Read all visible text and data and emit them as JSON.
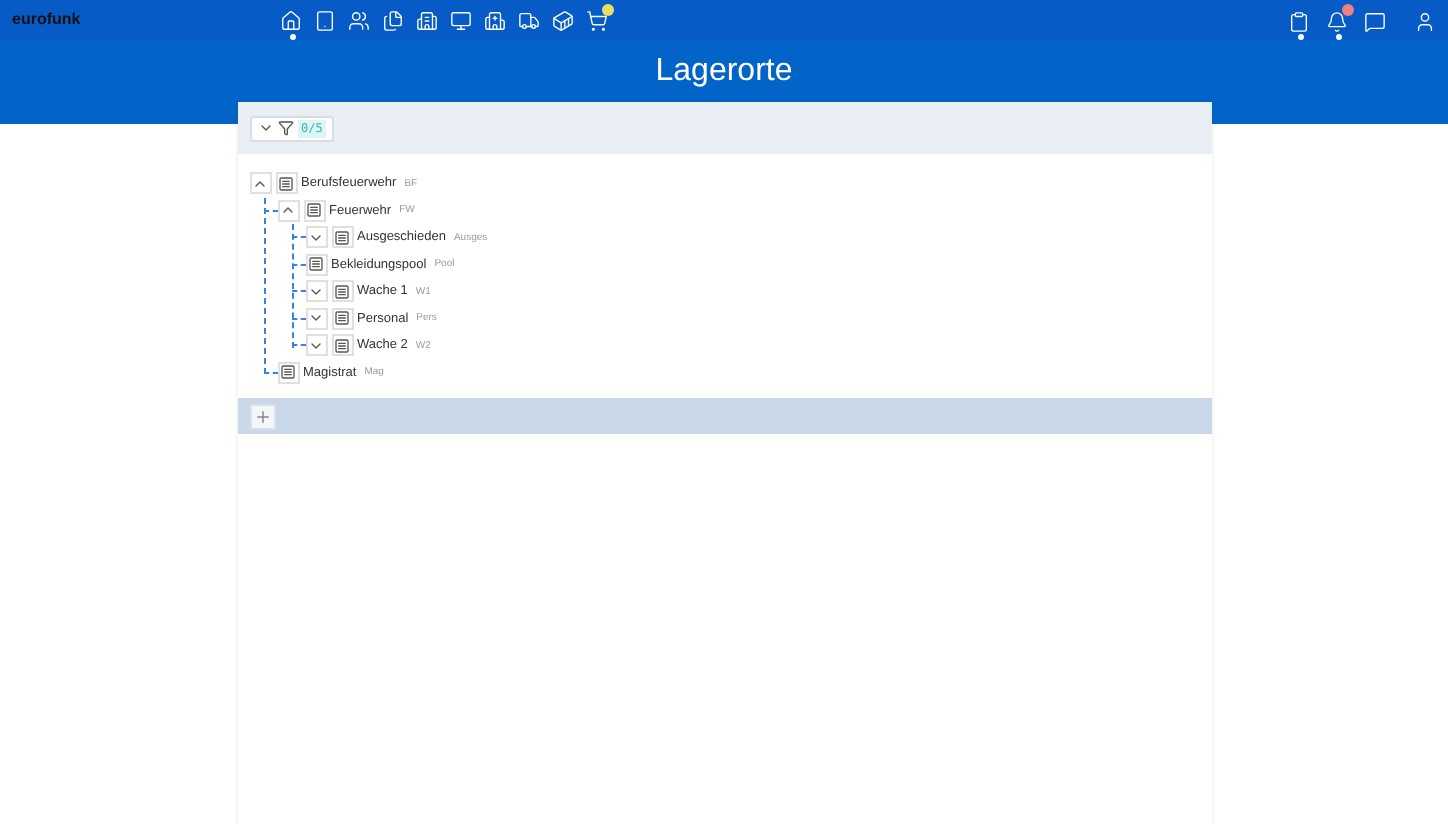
{
  "app": {
    "logo": "eurofunk"
  },
  "header": {
    "title": "Lagerorte"
  },
  "toolbar": {
    "filter_count": "0/5"
  },
  "tree": [
    {
      "name": "Berufsfeuerwehr",
      "code": "BF",
      "kind": "folder",
      "expanded": true,
      "children": [
        {
          "name": "Feuerwehr",
          "code": "FW",
          "kind": "folder",
          "expanded": true,
          "children": [
            {
              "name": "Ausgeschieden",
              "code": "Ausges",
              "kind": "folder",
              "expanded": false
            },
            {
              "name": "Bekleidungspool",
              "code": "Pool",
              "kind": "leaf"
            },
            {
              "name": "Wache 1",
              "code": "W1",
              "kind": "folder",
              "expanded": false
            },
            {
              "name": "Personal",
              "code": "Pers",
              "kind": "folder",
              "expanded": false
            },
            {
              "name": "Wache 2",
              "code": "W2",
              "kind": "folder",
              "expanded": false
            }
          ]
        },
        {
          "name": "Magistrat",
          "code": "Mag",
          "kind": "leaf"
        }
      ]
    }
  ]
}
